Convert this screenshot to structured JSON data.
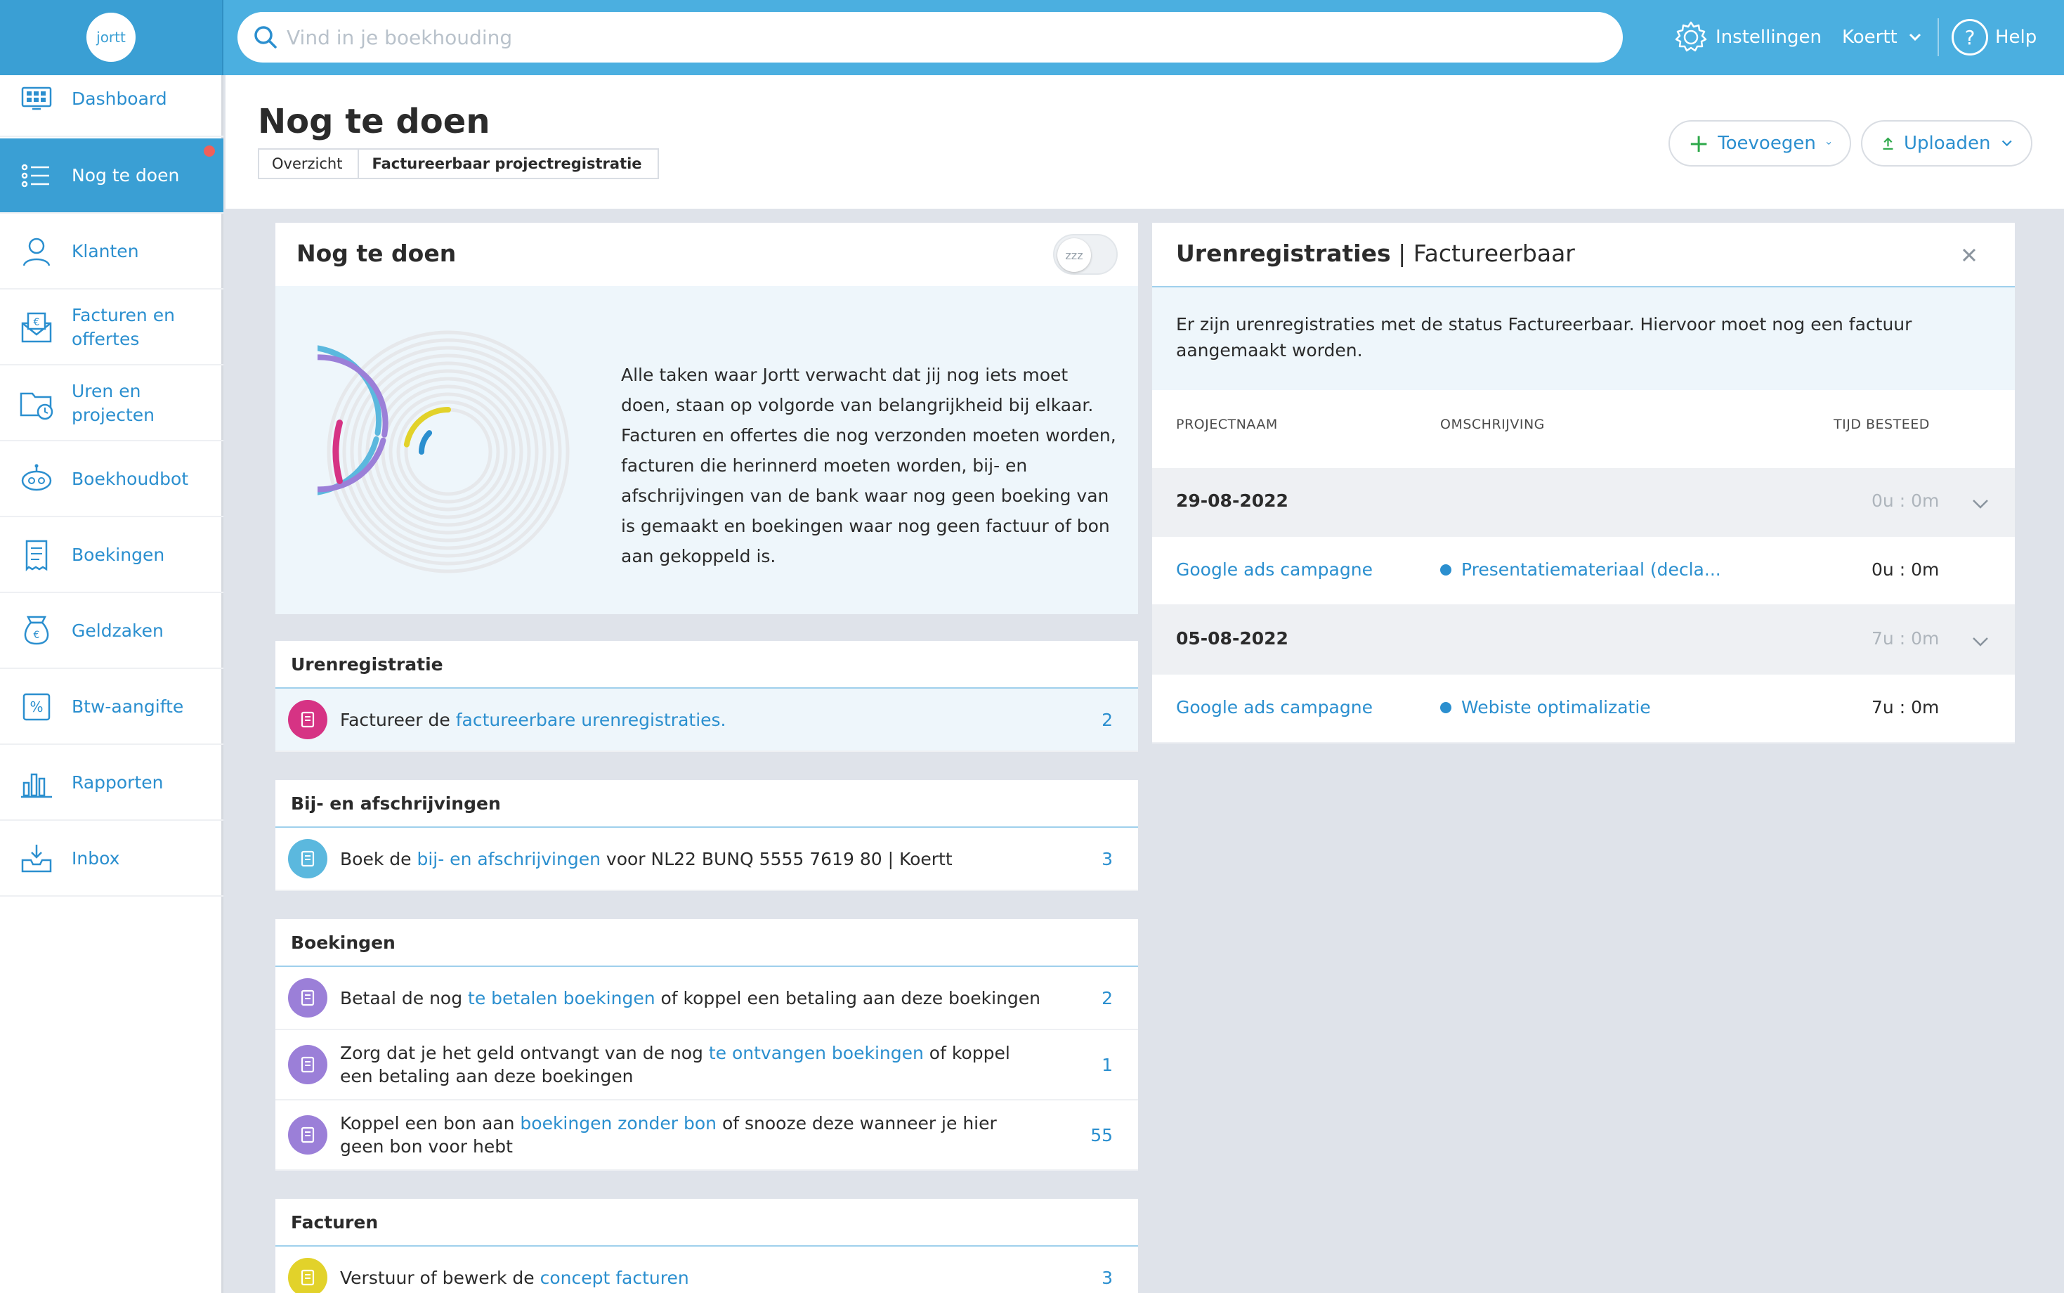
{
  "topbar": {
    "logo_text": "jortt",
    "search_placeholder": "Vind in je boekhouding",
    "settings_label": "Instellingen",
    "user_label": "Koertt",
    "help_label": "Help"
  },
  "sidebar": {
    "items": [
      {
        "label": "Dashboard",
        "icon": "dashboard-icon"
      },
      {
        "label": "Nog te doen",
        "icon": "checklist-icon",
        "active": true,
        "notification": true
      },
      {
        "label": "Klanten",
        "icon": "customer-icon"
      },
      {
        "label": "Facturen en offertes",
        "icon": "invoice-envelope-icon"
      },
      {
        "label": "Uren en projecten",
        "icon": "folder-clock-icon"
      },
      {
        "label": "Boekhoudbot",
        "icon": "robot-icon"
      },
      {
        "label": "Boekingen",
        "icon": "receipt-icon"
      },
      {
        "label": "Geldzaken",
        "icon": "money-bag-icon"
      },
      {
        "label": "Btw-aangifte",
        "icon": "percent-icon"
      },
      {
        "label": "Rapporten",
        "icon": "bar-chart-icon"
      },
      {
        "label": "Inbox",
        "icon": "inbox-icon"
      }
    ]
  },
  "header": {
    "title": "Nog te doen",
    "breadcrumb": [
      "Overzicht",
      "Factureerbaar projectregistratie"
    ],
    "add_label": "Toevoegen",
    "upload_label": "Uploaden"
  },
  "todo": {
    "title": "Nog te doen",
    "snooze_glyph": "zzz",
    "description": "Alle taken waar Jortt verwacht dat jij nog iets moet doen, staan op volgorde van belangrijkheid bij elkaar. Facturen en offertes die nog verzonden moeten worden, facturen die herinnerd moeten worden, bij- en afschrijvingen van de bank waar nog geen boeking van is gemaakt en boekingen waar nog geen factuur of bon aan gekoppeld is."
  },
  "sections": {
    "uren": {
      "title": "Urenregistratie",
      "rows": [
        {
          "pre": "Factureer de ",
          "link": "factureerbare urenregistraties.",
          "post": "",
          "count": "2"
        }
      ]
    },
    "bank": {
      "title": "Bij- en afschrijvingen",
      "rows": [
        {
          "pre": "Boek de ",
          "link": "bij- en afschrijvingen",
          "post": " voor NL22 BUNQ 5555 7619 80 | Koertt",
          "count": "3"
        }
      ]
    },
    "boekingen": {
      "title": "Boekingen",
      "rows": [
        {
          "pre": "Betaal de nog ",
          "link": "te betalen boekingen",
          "post": " of koppel een betaling aan deze boekingen",
          "count": "2"
        },
        {
          "pre": "Zorg dat je het geld ontvangt van de nog ",
          "link": "te ontvangen boekingen",
          "post": " of koppel een betaling aan deze boekingen",
          "count": "1"
        },
        {
          "pre": "Koppel een bon aan ",
          "link": "boekingen zonder bon",
          "post": " of snooze deze wanneer je hier geen bon voor hebt",
          "count": "55"
        }
      ]
    },
    "facturen": {
      "title": "Facturen",
      "rows": [
        {
          "pre": "Verstuur of bewerk de ",
          "link": "concept facturen",
          "post": "",
          "count": "3"
        }
      ]
    }
  },
  "uren_panel": {
    "title_bold": "Urenregistraties",
    "title_rest": " | Factureerbaar",
    "info": "Er zijn urenregistraties met de status Factureerbaar. Hiervoor moet nog een factuur aangemaakt worden.",
    "columns": [
      "PROJECTNAAM",
      "OMSCHRIJVING",
      "TIJD BESTEED"
    ],
    "groups": [
      {
        "date": "29-08-2022",
        "total": "0u : 0m",
        "entries": [
          {
            "project": "Google ads campagne",
            "description": "Presentatiemateriaal (decla...",
            "time": "0u : 0m"
          }
        ]
      },
      {
        "date": "05-08-2022",
        "total": "7u : 0m",
        "entries": [
          {
            "project": "Google ads campagne",
            "description": "Webiste optimalizatie",
            "time": "7u : 0m"
          }
        ]
      }
    ]
  },
  "colors": {
    "accent": "#3a9fd4",
    "topbar": "#4bafe0",
    "link": "#2b8fcf",
    "notification": "#f0605a",
    "uren_icon": "#d63384",
    "bank_icon": "#5bb8de",
    "boekingen_icon": "#9b7fd8",
    "facturen_icon": "#e2d22a"
  }
}
